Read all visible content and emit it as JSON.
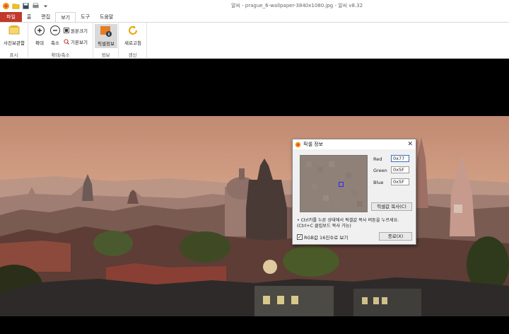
{
  "window": {
    "title": "알씨 - prague_6-wallpaper-3840x1080.jpg - 알씨 v8.32"
  },
  "tabs": [
    {
      "label": "파일"
    },
    {
      "label": "홈"
    },
    {
      "label": "편집"
    },
    {
      "label": "보기"
    },
    {
      "label": "도구"
    },
    {
      "label": "도움말"
    }
  ],
  "ribbon": {
    "display_group": {
      "label": "표시",
      "viewer_btn": "사진보관함"
    },
    "zoom_group": {
      "label": "확대/축소",
      "zoom_in": "확대",
      "zoom_out": "축소",
      "original": "원본크기",
      "default_view": "기본보기"
    },
    "info_group": {
      "label": "정보",
      "pixel_info": "픽셀정보"
    },
    "refresh_group": {
      "label": "갱신",
      "refresh": "새로고침"
    }
  },
  "dialog": {
    "title": "픽셀 정보",
    "red_label": "Red",
    "green_label": "Green",
    "blue_label": "Blue",
    "red_value": "0x77",
    "green_value": "0x5F",
    "blue_value": "0x5F",
    "copy_button": "픽셀값 복사(C)",
    "note": "• Ctrl키를 누른 상태에서 픽셀값 복사 버튼을 누르세요.\n  (Ctrl+C 클립보드 복사 가능)",
    "hex_checkbox": "RGB값 16진수로 보기",
    "hex_checked": true,
    "close_button": "종료(X)"
  },
  "colors": {
    "file_tab": "#c0392b",
    "sky_top": "#c99379",
    "sky_bottom": "#d8a98e",
    "pixel_sample": "#775f5f"
  }
}
